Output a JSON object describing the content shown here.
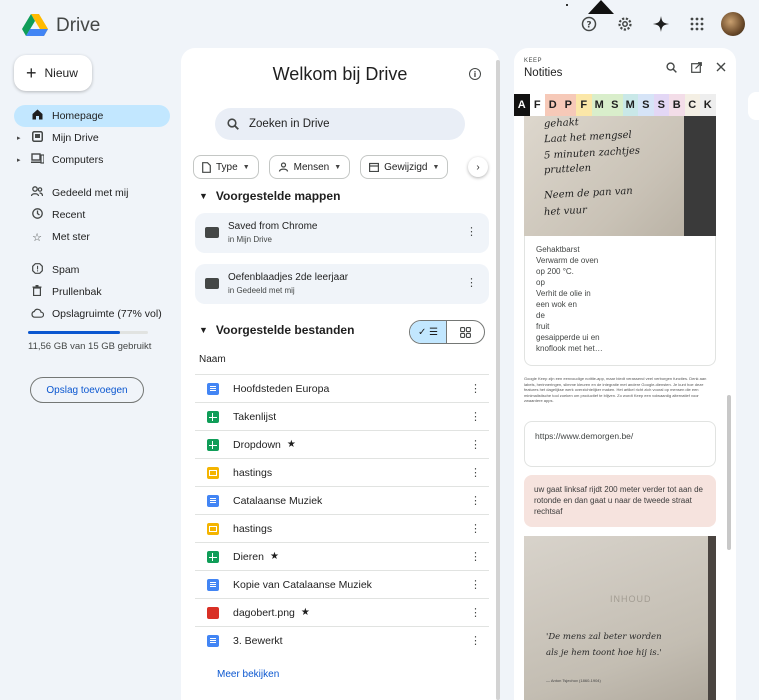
{
  "app": {
    "title": "Drive"
  },
  "topbar": {
    "help_icon": "help-icon",
    "settings_icon": "gear-icon",
    "gemini_icon": "sparkle-icon",
    "apps_icon": "apps-grid-icon"
  },
  "sidebar": {
    "new_label": "Nieuw",
    "items": [
      {
        "label": "Homepage",
        "icon": "home-icon",
        "active": true
      },
      {
        "label": "Mijn Drive",
        "icon": "my-drive-icon",
        "expandable": true
      },
      {
        "label": "Computers",
        "icon": "computer-icon",
        "expandable": true
      },
      {
        "label": "Gedeeld met mij",
        "icon": "shared-icon"
      },
      {
        "label": "Recent",
        "icon": "clock-icon"
      },
      {
        "label": "Met ster",
        "icon": "star-icon"
      },
      {
        "label": "Spam",
        "icon": "spam-icon"
      },
      {
        "label": "Prullenbak",
        "icon": "trash-icon"
      },
      {
        "label": "Opslagruimte (77% vol)",
        "icon": "cloud-icon"
      }
    ],
    "storage": {
      "used_fraction": 0.77,
      "text": "11,56 GB van 15 GB gebruikt"
    },
    "add_storage_label": "Opslag toevoegen"
  },
  "main": {
    "title": "Welkom bij Drive",
    "search_placeholder": "Zoeken in Drive",
    "filters": [
      {
        "label": "Type",
        "icon": "file-icon"
      },
      {
        "label": "Mensen",
        "icon": "people-icon"
      },
      {
        "label": "Gewijzigd",
        "icon": "calendar-icon"
      }
    ],
    "folders_header": "Voorgestelde mappen",
    "folders": [
      {
        "name": "Saved from Chrome",
        "location": "in Mijn Drive"
      },
      {
        "name": "Oefenblaadjes 2de leerjaar",
        "location": "in Gedeeld met mij"
      }
    ],
    "files_header": "Voorgestelde bestanden",
    "column_name": "Naam",
    "files": [
      {
        "name": "Hoofdsteden Europa",
        "type": "doc",
        "starred": false
      },
      {
        "name": "Takenlijst",
        "type": "sheet",
        "starred": false
      },
      {
        "name": "Dropdown",
        "type": "sheet",
        "starred": true
      },
      {
        "name": "hastings",
        "type": "slide",
        "starred": false
      },
      {
        "name": "Catalaanse Muziek",
        "type": "doc",
        "starred": false
      },
      {
        "name": "hastings",
        "type": "slide",
        "starred": false
      },
      {
        "name": "Dieren",
        "type": "sheet",
        "starred": true
      },
      {
        "name": "Kopie van Catalaanse Muziek",
        "type": "doc",
        "starred": false
      },
      {
        "name": "dagobert.png",
        "type": "img",
        "starred": true
      },
      {
        "name": "3. Bewerkt",
        "type": "doc",
        "starred": false
      }
    ],
    "star_glyph": "★",
    "more_label": "Meer bekijken"
  },
  "keep": {
    "brand": "KEEP",
    "title": "Notities",
    "letters": [
      "A",
      "F",
      "D",
      "P",
      "F",
      "M",
      "S",
      "M",
      "S",
      "S",
      "B",
      "C",
      "K"
    ],
    "letter_colors": [
      "#111111",
      "#ffffff",
      "#f6c9b8",
      "#f6c9b8",
      "#fbe7a8",
      "#d9eecb",
      "#d9eecb",
      "#c9e8e8",
      "#d6e4f7",
      "#e3d7f5",
      "#f3dde8",
      "#f4efe4",
      "#eeeeee"
    ],
    "handwriting": [
      "gehakt",
      "Laat het mengsel",
      "5 minuten zachtjes",
      "pruttelen",
      "Neem de pan van",
      "het vuur"
    ],
    "note1_lines": [
      "Gehaktbarst",
      "Verwarm de oven",
      "op 200 °C.",
      "op",
      "Verhit de olie in",
      "een wok en",
      "de",
      "fruit",
      "gesaipperde ui en",
      "knoflook met het…"
    ],
    "tiny_text": "Google Keep zijn een eenvoudige notitie-app, maar biedt verassend veel verborgen functies. Denk aan labels, herinneringen, slimme kleuren en de integratie met andere Google-diensten. Je kunt hoe deze features het dagelijkse werk overzichtelijker maken. Het artikel richt zich vooral op mensen die een minimalistische tool zoeken om productief te blijven. Zo wordt Keep een volwaardig alternatief voor zwaardere apps.",
    "url_note": "https://www.demorgen.be/",
    "route_note": "uw gaat linksaf rijdt 200 meter verder tot aan de rotonde en dan gaat u naar de tweede straat rechtsaf",
    "book": {
      "heading": "INHOUD",
      "quote1": "'De mens zal beter worden",
      "quote2": "als je hem toont hoe hij is.'",
      "attribution": "— Anton Tsjechov (1860-1904)"
    }
  }
}
